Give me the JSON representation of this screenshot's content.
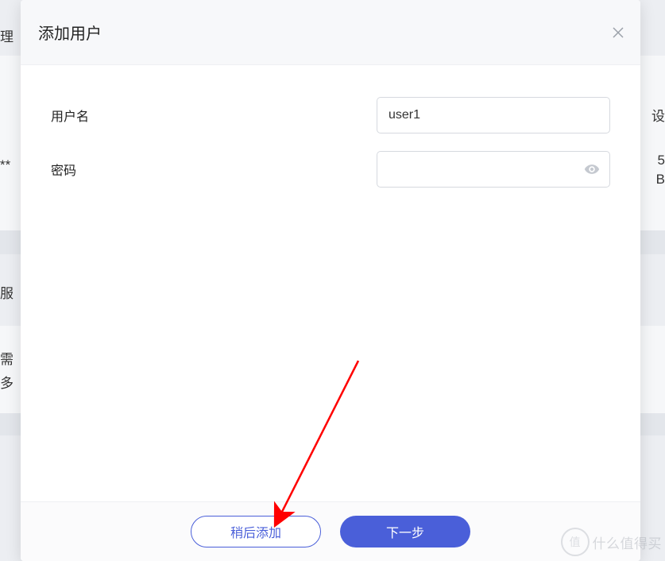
{
  "backdrop": {
    "text1": "理",
    "text2": "**",
    "text3": "服",
    "text4": "需",
    "text5": "多",
    "right1": "设",
    "right2": "5",
    "right3": "B"
  },
  "modal": {
    "title": "添加用户",
    "form": {
      "username_label": "用户名",
      "username_value": "user1",
      "password_label": "密码",
      "password_value": ""
    },
    "footer": {
      "later_label": "稍后添加",
      "next_label": "下一步"
    }
  },
  "watermark": {
    "circle": "值",
    "text": "什么值得买"
  }
}
